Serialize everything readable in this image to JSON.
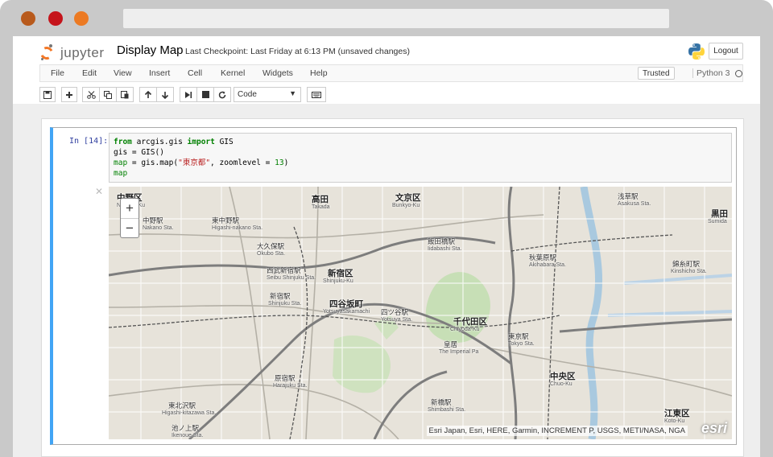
{
  "app": {
    "logo_text": "jupyter",
    "notebook_title": "Display Map",
    "checkpoint": "Last Checkpoint: Last Friday at 6:13 PM (unsaved changes)",
    "logout_label": "Logout",
    "trusted_label": "Trusted",
    "kernel_name": "Python 3"
  },
  "menu": {
    "items": [
      "File",
      "Edit",
      "View",
      "Insert",
      "Cell",
      "Kernel",
      "Widgets",
      "Help"
    ]
  },
  "toolbar": {
    "cell_type": "Code",
    "icons": [
      "save-icon",
      "plus-icon",
      "cut-icon",
      "copy-icon",
      "paste-icon",
      "arrow-up-icon",
      "arrow-down-icon",
      "step-forward-icon",
      "stop-icon",
      "restart-icon",
      "keyboard-icon"
    ]
  },
  "cell": {
    "prompt": "In [14]:",
    "code": {
      "line1": {
        "kw1": "from",
        "mid": " arcgis.gis ",
        "kw2": "import",
        "tail": " GIS"
      },
      "line2": "gis = GIS()",
      "line3": {
        "var": "map",
        "pre": " = gis.map(",
        "str": "\"東京都\"",
        "mid": ", zoomlevel = ",
        "num": "13",
        "post": ")"
      },
      "line4": "map"
    }
  },
  "map": {
    "zoom_in": "+",
    "zoom_out": "−",
    "attribution": "Esri Japan, Esri, HERE, Garmin, INCREMENT P, USGS, METI/NASA, NGA",
    "brand": "esri",
    "labels": [
      {
        "ja": "中野区",
        "en": "Nakano-Ku"
      },
      {
        "ja": "中野駅",
        "en": "Nakano Sta."
      },
      {
        "ja": "東中野駅",
        "en": "Higashi-nakano Sta."
      },
      {
        "ja": "高田",
        "en": "Takada"
      },
      {
        "ja": "文京区",
        "en": "Bunkyo-Ku"
      },
      {
        "ja": "浅草駅",
        "en": "Asakusa Sta."
      },
      {
        "ja": "黒田",
        "en": "Sumida"
      },
      {
        "ja": "大久保駅",
        "en": "Okubo Sta."
      },
      {
        "ja": "飯田橋駅",
        "en": "Iidabashi Sta."
      },
      {
        "ja": "秋葉原駅",
        "en": "Akihabara Sta."
      },
      {
        "ja": "西武新宿駅",
        "en": "Seibu Shinjuku Sta."
      },
      {
        "ja": "新宿区",
        "en": "Shinjuku-Ku"
      },
      {
        "ja": "錦糸町駅",
        "en": "Kinshicho Sta."
      },
      {
        "ja": "新宿駅",
        "en": "Shinjuku Sta."
      },
      {
        "ja": "四谷坂町",
        "en": "Yotsuyasakamachi"
      },
      {
        "ja": "四ツ谷駅",
        "en": "Yotsuya Sta."
      },
      {
        "ja": "千代田区",
        "en": "Chiyoda-Ku"
      },
      {
        "ja": "皇居",
        "en": "The Imperial Pa"
      },
      {
        "ja": "東京駅",
        "en": "Tokyo Sta."
      },
      {
        "ja": "原宿駅",
        "en": "Harajuku Sta."
      },
      {
        "ja": "中央区",
        "en": "Chuo-Ku"
      },
      {
        "ja": "東北沢駅",
        "en": "Higashi-kitazawa Sta."
      },
      {
        "ja": "新橋駅",
        "en": "Shimbashi Sta."
      },
      {
        "ja": "池ノ上駅",
        "en": "Ikenoue Sta."
      },
      {
        "ja": "江東区",
        "en": "Koto-Ku"
      }
    ]
  }
}
